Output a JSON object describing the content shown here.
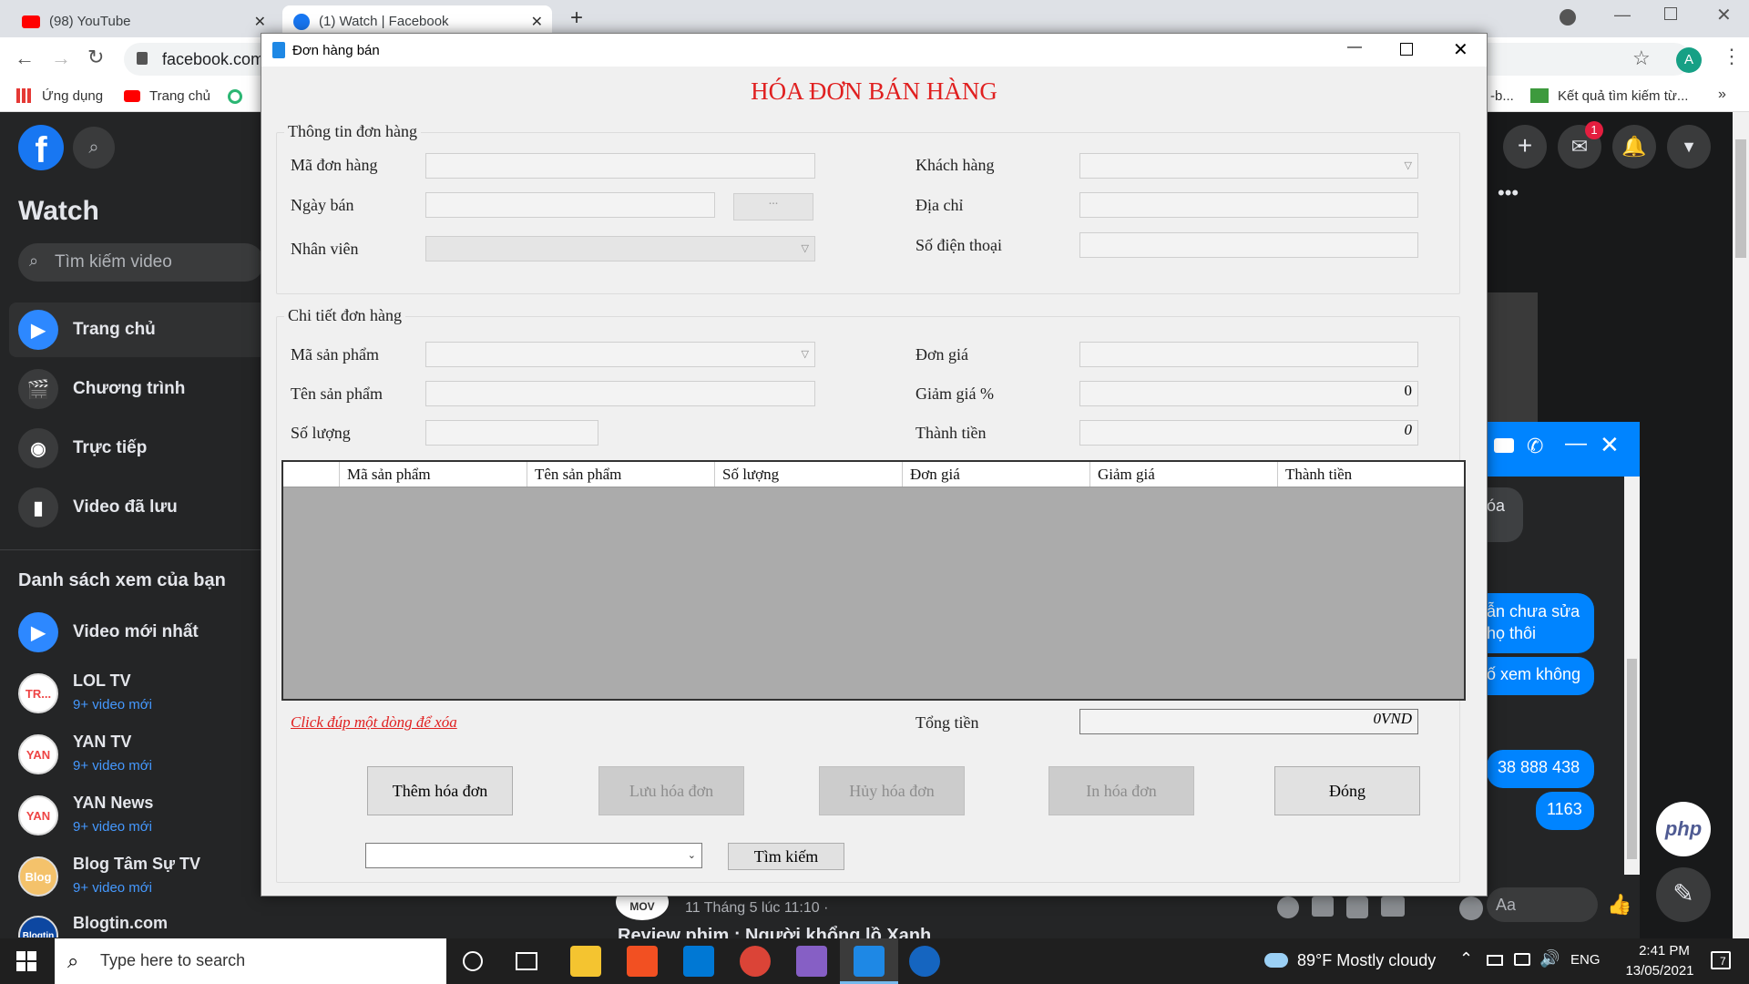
{
  "browser": {
    "tabs": [
      {
        "label": "(98) YouTube"
      },
      {
        "label": "(1) Watch | Facebook"
      }
    ],
    "url": "facebook.com",
    "profile_initial": "A",
    "bookmarks": [
      "Ứng dụng",
      "Trang chủ",
      "Kết quả tìm kiếm từ..."
    ],
    "bookmark_partial": "-b..."
  },
  "facebook": {
    "watch_title": "Watch",
    "search_placeholder": "Tìm kiếm video",
    "nav": [
      "Trang chủ",
      "Chương trình",
      "Trực tiếp",
      "Video đã lưu"
    ],
    "section_title": "Danh sách xem của bạn",
    "latest": "Video mới nhất",
    "channels": [
      {
        "name": "LOL TV",
        "sub": "9+ video mới",
        "badge": "TR..."
      },
      {
        "name": "YAN TV",
        "sub": "9+ video mới",
        "badge": "YAN"
      },
      {
        "name": "YAN News",
        "sub": "9+ video mới",
        "badge": "YAN"
      },
      {
        "name": "Blog Tâm Sự TV",
        "sub": "9+ video mới",
        "badge": "Blog"
      },
      {
        "name": "Blogtin.com",
        "sub": "",
        "badge": "Blogtin"
      }
    ],
    "post_time": "11 Tháng 5 lúc 11:10 ·",
    "post_title": "Review phim : Người khổng lồ Xanh",
    "post_avatar": "MOV",
    "notif_count": "1",
    "chat": {
      "partial_1": "óa",
      "msg_1a": "ẫn chưa sửa",
      "msg_1b": "họ thôi",
      "msg_2": "ố xem không",
      "msg_3": "38 888 438",
      "msg_4": "1163",
      "input_placeholder": "Aa"
    },
    "php_badge": "php"
  },
  "dialog": {
    "window_title": "Đơn hàng bán",
    "heading": "HÓA ĐƠN BÁN HÀNG",
    "heading_color": "#e02020",
    "order_info": {
      "title": "Thông tin đơn hàng",
      "ma_don_hang": "Mã đơn hàng",
      "ngay_ban": "Ngày bán",
      "nhan_vien": "Nhân viên",
      "khach_hang": "Khách hàng",
      "dia_chi": "Địa chỉ",
      "so_dien_thoai": "Số điện thoại",
      "date_button": "..."
    },
    "order_detail": {
      "title": "Chi tiết đơn hàng",
      "ma_san_pham": "Mã sản phẩm",
      "ten_san_pham": "Tên sản phẩm",
      "so_luong": "Số lượng",
      "don_gia": "Đơn giá",
      "giam_gia": "Giảm giá %",
      "thanh_tien": "Thành tiền",
      "giam_gia_value": "0",
      "thanh_tien_value": "0"
    },
    "grid_columns": [
      "Mã sản phẩm",
      "Tên sản phẩm",
      "Số lượng",
      "Đơn giá",
      "Giảm giá",
      "Thành tiền"
    ],
    "hint": "Click đúp một dòng để xóa",
    "tong_tien_label": "Tổng tiền",
    "tong_tien_value": "0VND",
    "buttons": {
      "them": "Thêm hóa đơn",
      "luu": "Lưu hóa đơn",
      "huy": "Hủy hóa đơn",
      "in": "In hóa đơn",
      "dong": "Đóng",
      "tim_kiem": "Tìm kiếm"
    }
  },
  "taskbar": {
    "search_placeholder": "Type here to search",
    "weather": "89°F  Mostly cloudy",
    "lang": "ENG",
    "time": "2:41 PM",
    "date": "13/05/2021",
    "notif": "7"
  }
}
